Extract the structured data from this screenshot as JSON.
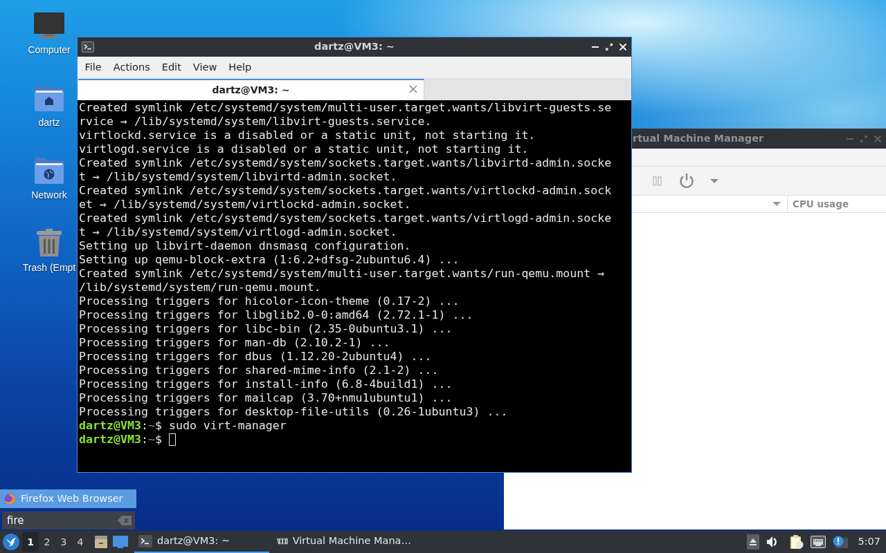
{
  "desktop_icons": [
    {
      "kind": "computer",
      "label": "Computer"
    },
    {
      "kind": "home",
      "label": "dartz"
    },
    {
      "kind": "network",
      "label": "Network"
    },
    {
      "kind": "trash",
      "label": "Trash (Empt"
    }
  ],
  "vm_manager_window": {
    "title": "rtual Machine Manager",
    "active": false,
    "columns": [
      "CPU usage"
    ]
  },
  "terminal_window": {
    "title": "dartz@VM3: ~",
    "active": true,
    "menu": [
      "File",
      "Actions",
      "Edit",
      "View",
      "Help"
    ],
    "tabs": [
      {
        "label": "dartz@VM3: ~",
        "selected": true
      }
    ],
    "lines": [
      {
        "kind": "output",
        "text": "Created symlink /etc/systemd/system/multi-user.target.wants/libvirt-guests.se"
      },
      {
        "kind": "output",
        "text": "rvice → /lib/systemd/system/libvirt-guests.service."
      },
      {
        "kind": "output",
        "text": "virtlockd.service is a disabled or a static unit, not starting it."
      },
      {
        "kind": "output",
        "text": "virtlogd.service is a disabled or a static unit, not starting it."
      },
      {
        "kind": "output",
        "text": "Created symlink /etc/systemd/system/sockets.target.wants/libvirtd-admin.socke"
      },
      {
        "kind": "output",
        "text": "t → /lib/systemd/system/libvirtd-admin.socket."
      },
      {
        "kind": "output",
        "text": "Created symlink /etc/systemd/system/sockets.target.wants/virtlockd-admin.sock"
      },
      {
        "kind": "output",
        "text": "et → /lib/systemd/system/virtlockd-admin.socket."
      },
      {
        "kind": "output",
        "text": "Created symlink /etc/systemd/system/sockets.target.wants/virtlogd-admin.socke"
      },
      {
        "kind": "output",
        "text": "t → /lib/systemd/system/virtlogd-admin.socket."
      },
      {
        "kind": "output",
        "text": "Setting up libvirt-daemon dnsmasq configuration."
      },
      {
        "kind": "output",
        "text": "Setting up qemu-block-extra (1:6.2+dfsg-2ubuntu6.4) ..."
      },
      {
        "kind": "output",
        "text": "Created symlink /etc/systemd/system/multi-user.target.wants/run-qemu.mount →"
      },
      {
        "kind": "output",
        "text": "/lib/systemd/system/run-qemu.mount."
      },
      {
        "kind": "output",
        "text": "Processing triggers for hicolor-icon-theme (0.17-2) ..."
      },
      {
        "kind": "output",
        "text": "Processing triggers for libglib2.0-0:amd64 (2.72.1-1) ..."
      },
      {
        "kind": "output",
        "text": "Processing triggers for libc-bin (2.35-0ubuntu3.1) ..."
      },
      {
        "kind": "output",
        "text": "Processing triggers for man-db (2.10.2-1) ..."
      },
      {
        "kind": "output",
        "text": "Processing triggers for dbus (1.12.20-2ubuntu4) ..."
      },
      {
        "kind": "output",
        "text": "Processing triggers for shared-mime-info (2.1-2) ..."
      },
      {
        "kind": "output",
        "text": "Processing triggers for install-info (6.8-4build1) ..."
      },
      {
        "kind": "output",
        "text": "Processing triggers for mailcap (3.70+nmu1ubuntu1) ..."
      },
      {
        "kind": "output",
        "text": "Processing triggers for desktop-file-utils (0.26-1ubuntu3) ..."
      },
      {
        "kind": "prompt",
        "user": "dartz@VM3",
        "sep": ":",
        "path": "~",
        "symbol": "$",
        "command": "sudo virt-manager",
        "cursor": false
      },
      {
        "kind": "prompt",
        "user": "dartz@VM3",
        "sep": ":",
        "path": "~",
        "symbol": "$",
        "cursor": true
      }
    ]
  },
  "launcher": {
    "results": [
      {
        "label": "Firefox Web Browser",
        "selected": true
      }
    ],
    "search": {
      "value": "fire"
    }
  },
  "taskbar": {
    "desktops": [
      {
        "label": "1",
        "selected": true
      },
      {
        "label": "2",
        "selected": false
      },
      {
        "label": "3",
        "selected": false
      },
      {
        "label": "4",
        "selected": false
      }
    ],
    "tasks": [
      {
        "kind": "terminal",
        "label": "dartz@VM3: ~",
        "selected": true
      },
      {
        "kind": "vm",
        "label": "Virtual Machine Mana…",
        "selected": false
      }
    ],
    "clock": "5:07"
  }
}
